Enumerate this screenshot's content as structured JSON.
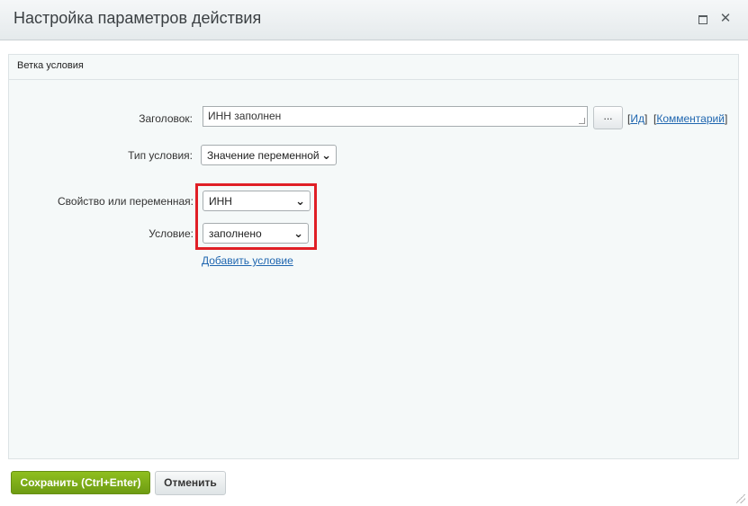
{
  "window": {
    "title": "Настройка параметров действия",
    "maximize_icon": "maximize-icon",
    "close_icon": "close-icon",
    "close_glyph": "✕"
  },
  "panel": {
    "header": "Ветка условия"
  },
  "form": {
    "title_label": "Заголовок:",
    "title_value": "ИНН заполнен",
    "dots_label": "...",
    "id_link": "Ид",
    "comment_link": "Комментарий",
    "type_label": "Тип условия:",
    "type_value": "Значение переменной",
    "property_label": "Свойство или переменная:",
    "property_value": "ИНН",
    "condition_label": "Условие:",
    "condition_value": "заполнено",
    "add_condition": "Добавить условие"
  },
  "buttons": {
    "save": "Сохранить (Ctrl+Enter)",
    "cancel": "Отменить"
  },
  "colors": {
    "highlight": "#e01f26",
    "save_green": "#7aaa17",
    "link_blue": "#2067b0"
  }
}
